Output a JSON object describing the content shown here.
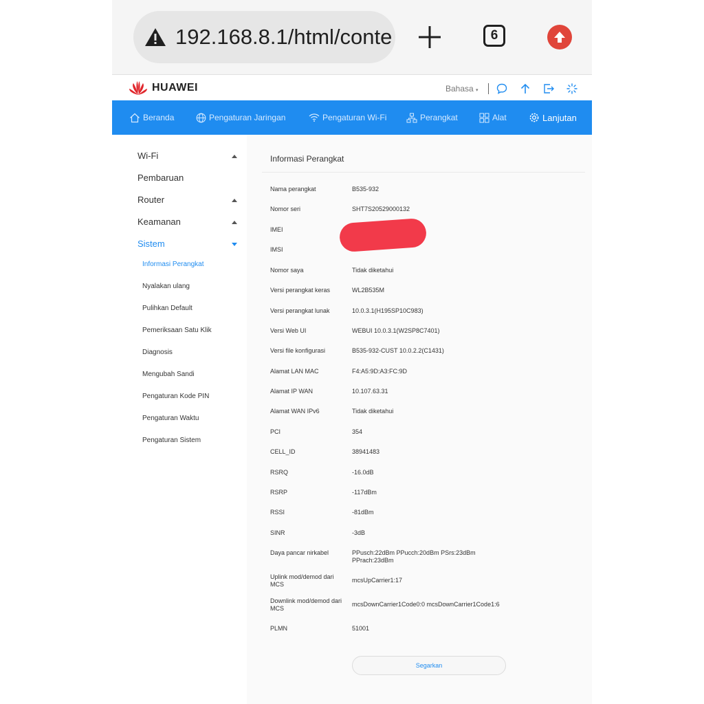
{
  "browser": {
    "url": "192.168.8.1/html/conte",
    "tab_count": "6"
  },
  "header": {
    "brand": "HUAWEI",
    "language_label": "Bahasa",
    "brand_color": "#e0262c"
  },
  "nav": {
    "items": [
      {
        "label": "Beranda",
        "icon": "home-icon"
      },
      {
        "label": "Pengaturan Jaringan",
        "icon": "globe-icon"
      },
      {
        "label": "Pengaturan Wi-Fi",
        "icon": "wifi-icon"
      },
      {
        "label": "Perangkat",
        "icon": "devices-icon"
      },
      {
        "label": "Alat",
        "icon": "tools-icon"
      },
      {
        "label": "Lanjutan",
        "icon": "gear-icon",
        "active": true
      }
    ],
    "accent_color": "#1f8cf0"
  },
  "sidebar": {
    "sections": [
      {
        "label": "Wi-Fi"
      },
      {
        "label": "Pembaruan"
      },
      {
        "label": "Router"
      },
      {
        "label": "Keamanan"
      },
      {
        "label": "Sistem",
        "active": true
      }
    ],
    "sub_items": [
      {
        "label": "Informasi Perangkat",
        "active": true
      },
      {
        "label": "Nyalakan ulang"
      },
      {
        "label": "Pulihkan Default"
      },
      {
        "label": "Pemeriksaan Satu Klik"
      },
      {
        "label": "Diagnosis"
      },
      {
        "label": "Mengubah Sandi"
      },
      {
        "label": "Pengaturan Kode PIN"
      },
      {
        "label": "Pengaturan Waktu"
      },
      {
        "label": "Pengaturan Sistem"
      }
    ]
  },
  "main": {
    "title": "Informasi Perangkat",
    "rows": [
      {
        "label": "Nama perangkat",
        "value": "B535-932"
      },
      {
        "label": "Nomor seri",
        "value": "SHT7S20529000132"
      },
      {
        "label": "IMEI",
        "value": ""
      },
      {
        "label": "IMSI",
        "value": ""
      },
      {
        "label": "Nomor saya",
        "value": "Tidak diketahui"
      },
      {
        "label": "Versi perangkat keras",
        "value": "WL2B535M"
      },
      {
        "label": "Versi perangkat lunak",
        "value": "10.0.3.1(H195SP10C983)"
      },
      {
        "label": "Versi Web UI",
        "value": "WEBUI 10.0.3.1(W2SP8C7401)"
      },
      {
        "label": "Versi file konfigurasi",
        "value": "B535-932-CUST 10.0.2.2(C1431)"
      },
      {
        "label": "Alamat LAN MAC",
        "value": "F4:A5:9D:A3:FC:9D"
      },
      {
        "label": "Alamat IP WAN",
        "value": "10.107.63.31"
      },
      {
        "label": "Alamat WAN IPv6",
        "value": "Tidak diketahui"
      },
      {
        "label": "PCI",
        "value": "354"
      },
      {
        "label": "CELL_ID",
        "value": "38941483"
      },
      {
        "label": "RSRQ",
        "value": "-16.0dB"
      },
      {
        "label": "RSRP",
        "value": "-117dBm"
      },
      {
        "label": "RSSI",
        "value": "-81dBm"
      },
      {
        "label": "SINR",
        "value": "-3dB"
      },
      {
        "label": "Daya pancar nirkabel",
        "value": "PPusch:22dBm PPucch:20dBm PSrs:23dBm PPrach:23dBm"
      },
      {
        "label": "Uplink mod/demod dari MCS",
        "value": "mcsUpCarrier1:17"
      },
      {
        "label": "Downlink mod/demod dari MCS",
        "value": "mcsDownCarrier1Code0:0 mcsDownCarrier1Code1:6"
      },
      {
        "label": "PLMN",
        "value": "51001"
      }
    ],
    "refresh_label": "Segarkan",
    "redaction_color": "#f23a4a"
  }
}
